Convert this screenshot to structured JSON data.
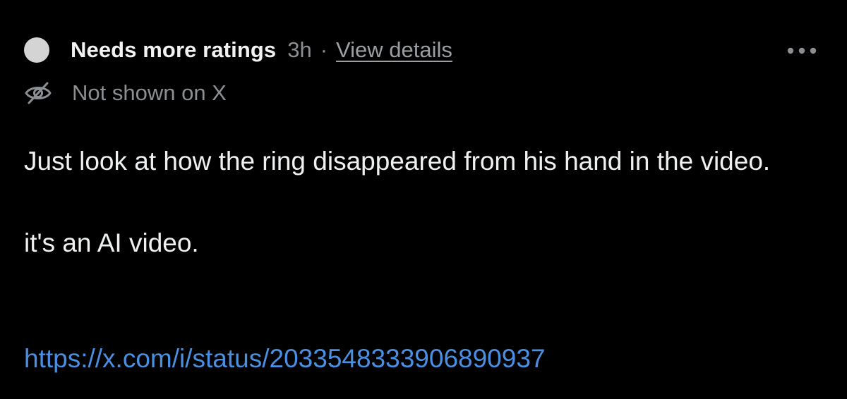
{
  "note": {
    "status": {
      "dot_icon": "status-dot-icon",
      "label": "Needs more ratings",
      "time": "3h",
      "separator": "·",
      "details_link": "View details"
    },
    "menu": {
      "icon": "more-horizontal-icon"
    },
    "visibility": {
      "icon": "eye-off-icon",
      "text": "Not shown on X"
    },
    "body": {
      "paragraph_1": "Just look at how the ring disappeared from his hand in the video.",
      "paragraph_2": "it's an AI video.",
      "link": "https://x.com/i/status/2033548333906890937"
    },
    "colors": {
      "background": "#000000",
      "text": "#eef0f1",
      "muted": "#8b8f94",
      "link": "#4a90e2",
      "status_dot": "#d4d4d4"
    }
  }
}
